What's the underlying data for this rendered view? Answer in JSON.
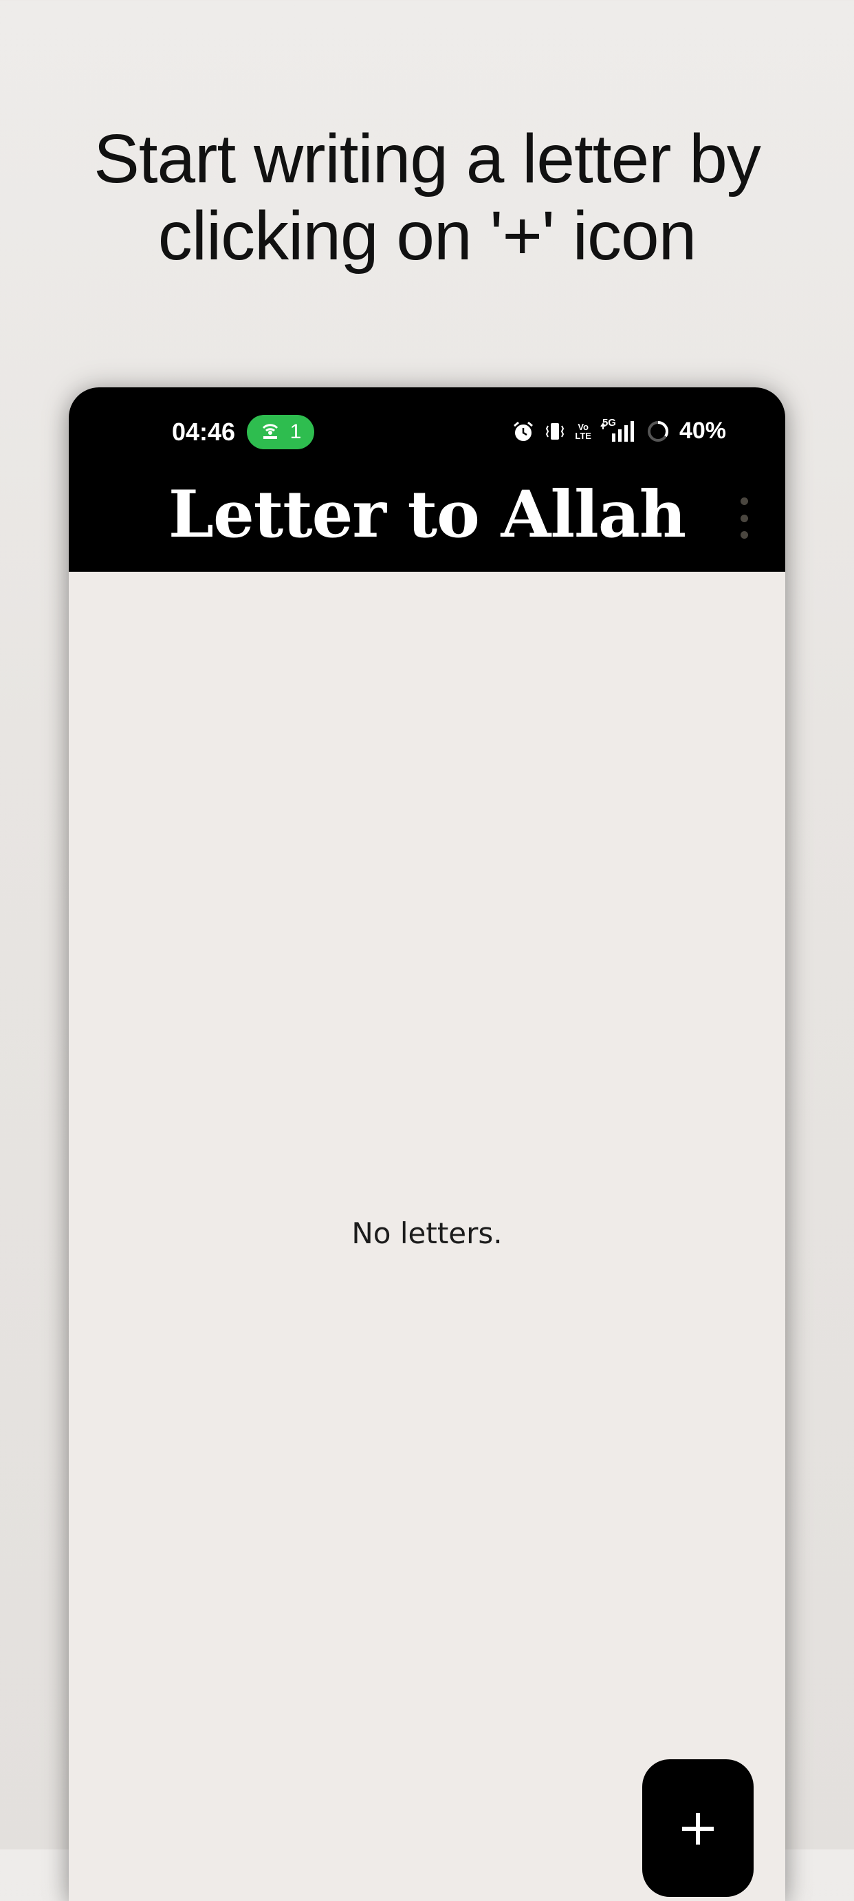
{
  "headline": {
    "line1": "Start writing a letter by",
    "line2": "clicking on '+' icon"
  },
  "status_bar": {
    "time": "04:46",
    "hotspot_count": "1",
    "network_label": "5G",
    "volte_top": "Vo",
    "volte_bottom": "LTE",
    "battery": "40%",
    "hotspot_color": "#2ebd4f"
  },
  "app_bar": {
    "title": "Letter to Allah",
    "menu_icon": "more-vert-icon"
  },
  "main": {
    "empty_message": "No letters."
  },
  "fab": {
    "icon": "plus-icon"
  }
}
